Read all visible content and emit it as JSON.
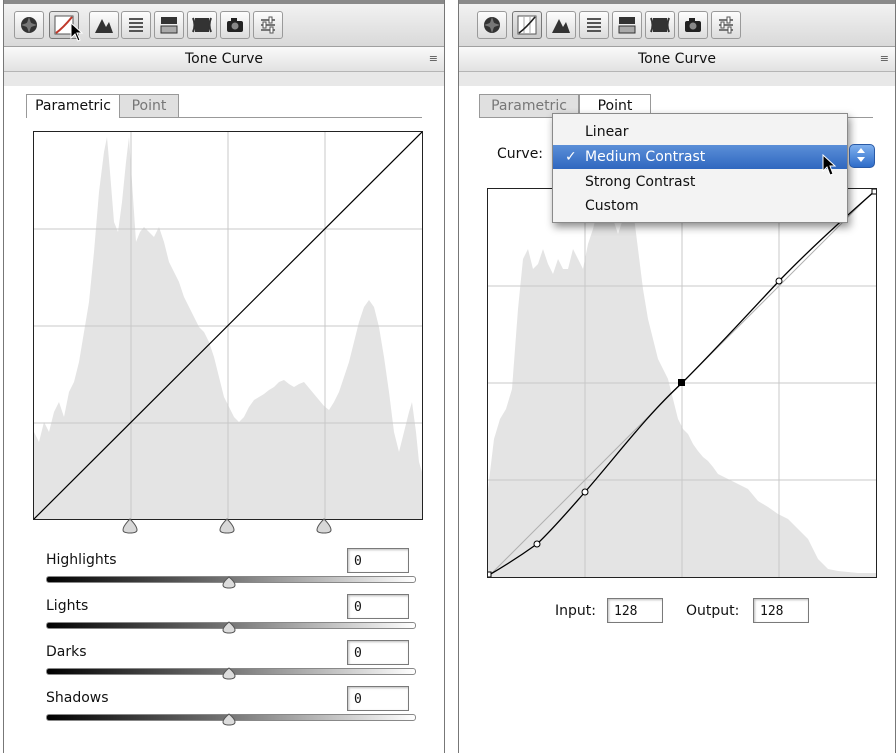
{
  "panel_title": "Tone Curve",
  "menu_icon": "≡",
  "tabs": {
    "parametric": "Parametric",
    "point": "Point"
  },
  "sliders": [
    {
      "label": "Highlights",
      "value": "0"
    },
    {
      "label": "Lights",
      "value": "0"
    },
    {
      "label": "Darks",
      "value": "0"
    },
    {
      "label": "Shadows",
      "value": "0"
    }
  ],
  "curve": {
    "label": "Curve:",
    "options": [
      "Linear",
      "Medium Contrast",
      "Strong Contrast",
      "Custom"
    ],
    "selected": "Medium Contrast",
    "check": "✓"
  },
  "io": {
    "input_label": "Input:",
    "input_value": "128",
    "output_label": "Output:",
    "output_value": "128"
  },
  "toolbar_icons": [
    "basic-icon",
    "tone-curve-icon",
    "detail-icon",
    "hsl-icon",
    "split-toning-icon",
    "lens-corrections-icon",
    "camera-calibration-icon",
    "presets-icon"
  ],
  "colors": {
    "selection": "#3a74c8",
    "histogram": "#e4e4e4"
  }
}
